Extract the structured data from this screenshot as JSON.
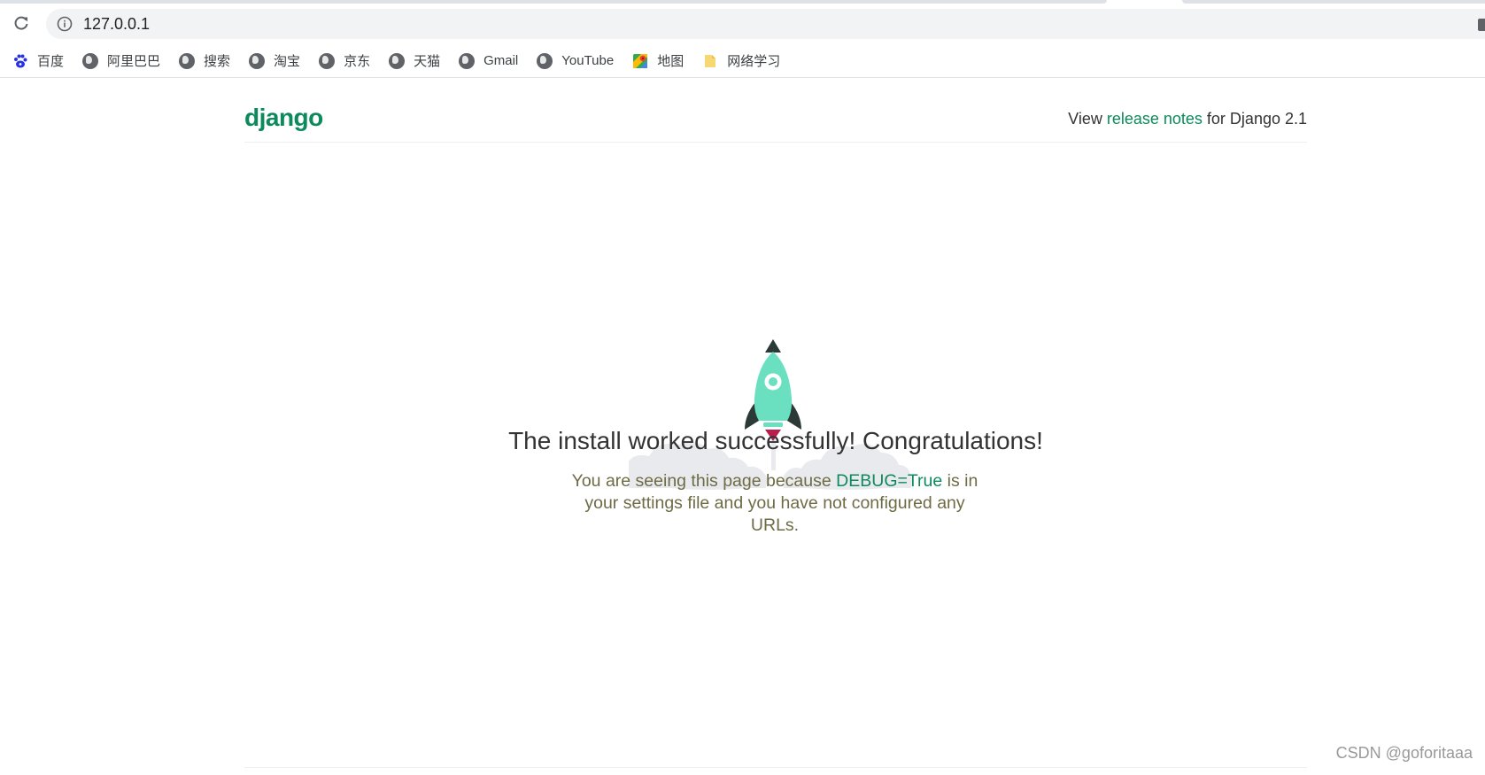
{
  "browser": {
    "url": "127.0.0.1",
    "bookmarks": [
      {
        "label": "百度",
        "icon": "baidu-paw-icon"
      },
      {
        "label": "阿里巴巴",
        "icon": "globe-icon"
      },
      {
        "label": "搜索",
        "icon": "globe-icon"
      },
      {
        "label": "淘宝",
        "icon": "globe-icon"
      },
      {
        "label": "京东",
        "icon": "globe-icon"
      },
      {
        "label": "天猫",
        "icon": "globe-icon"
      },
      {
        "label": "Gmail",
        "icon": "globe-icon"
      },
      {
        "label": "YouTube",
        "icon": "globe-icon"
      },
      {
        "label": "地图",
        "icon": "maps-icon"
      },
      {
        "label": "网络学习",
        "icon": "folder-icon"
      }
    ]
  },
  "page": {
    "logo": "django",
    "release_prefix": "View ",
    "release_link": "release notes",
    "release_suffix": " for Django 2.1",
    "headline": "The install worked successfully! Congratulations!",
    "sub_prefix": "You are seeing this page because ",
    "sub_debug": "DEBUG=True",
    "sub_suffix": " is in your settings file and you have not configured any URLs."
  },
  "watermark": "CSDN @goforitaaa",
  "colors": {
    "django_green": "#0c8a5c",
    "rocket_body": "#6be0c0",
    "rocket_fins": "#2b3a36",
    "flame": "#b81d4b",
    "cloud": "#e9eaed"
  }
}
